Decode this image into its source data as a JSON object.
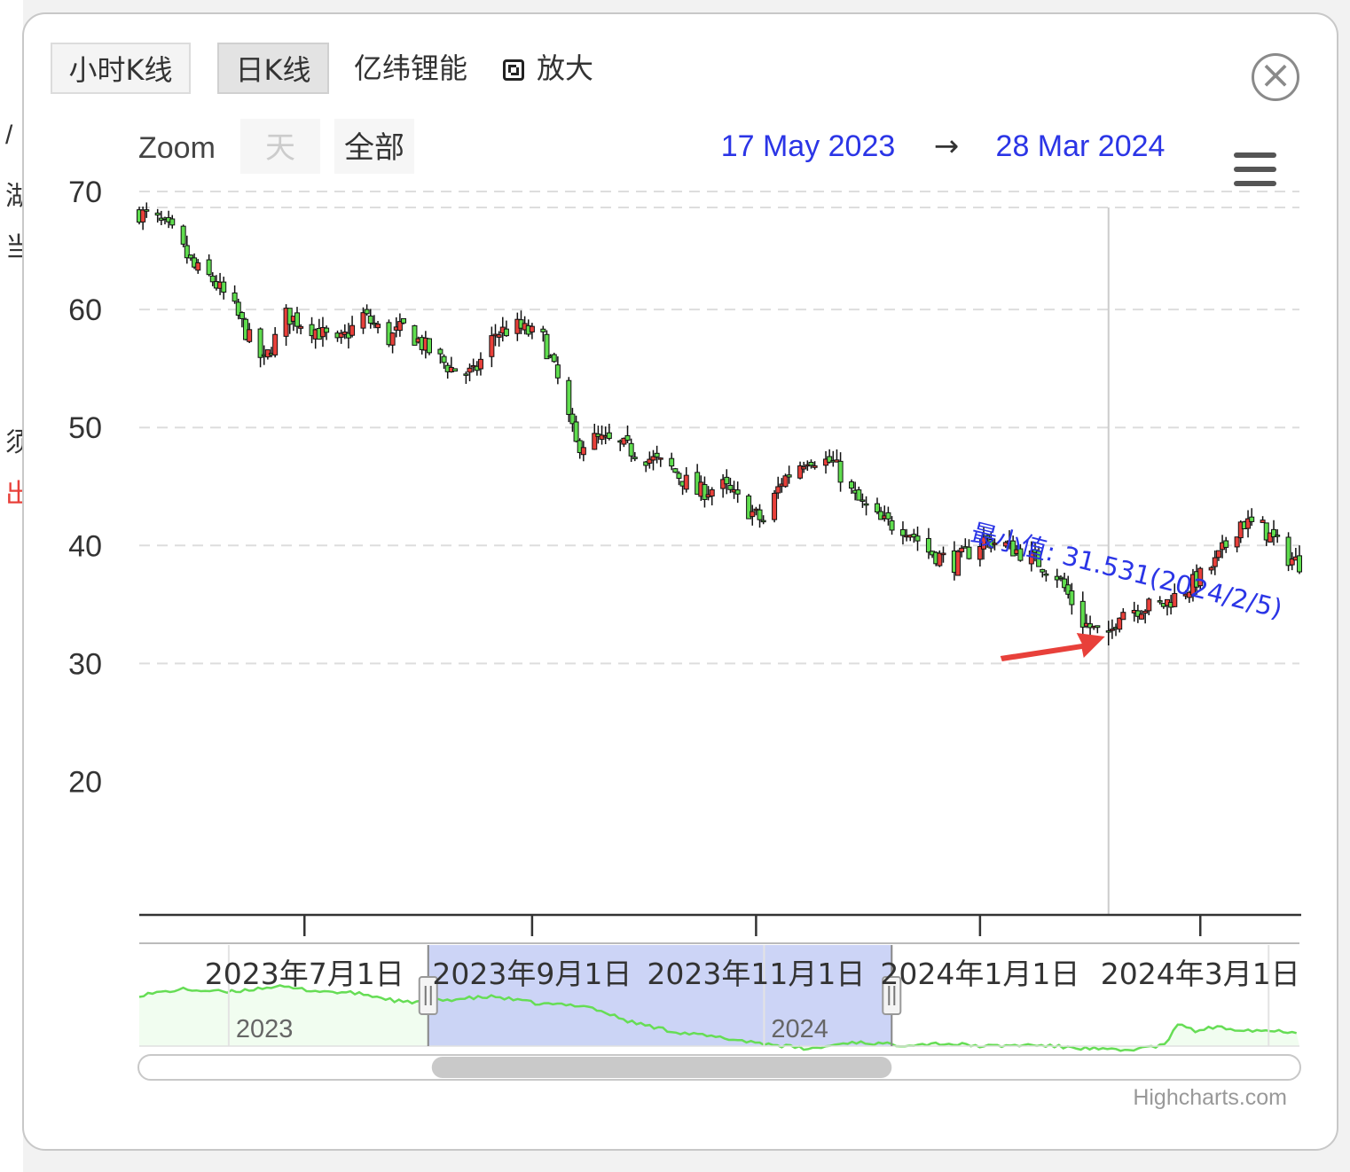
{
  "left_fragments": [
    "/",
    "湖",
    "当",
    "须",
    "出"
  ],
  "tabs": {
    "hour": "小时K线",
    "day": "日K线"
  },
  "stock_name": "亿纬锂能",
  "zoom_toggle": "放大",
  "close_icon": "close-icon",
  "menu_icon": "hamburger-menu-icon",
  "range_selector": {
    "label": "Zoom",
    "buttons": [
      "天",
      "全部"
    ]
  },
  "range_inputs": {
    "from": "17 May 2023",
    "arrow": "→",
    "to": "28 Mar 2024"
  },
  "credits": "Highcharts.com",
  "colors": {
    "up": "#e8403a",
    "down": "#5fdd4e",
    "link": "#2b35e6",
    "navigator_line": "#66dd55",
    "navigator_mask": "#c7cff5"
  },
  "chart_data": {
    "type": "candlestick",
    "y_ticks": [
      70,
      60,
      50,
      40,
      30,
      20
    ],
    "ylim": [
      20,
      75
    ],
    "x_start": "2023-05-17",
    "x_end": "2024-03-28",
    "x_ticks": [
      {
        "date": "2023-07-01",
        "label": "2023年7月1日"
      },
      {
        "date": "2023-09-01",
        "label": "2023年9月1日"
      },
      {
        "date": "2023-11-01",
        "label": "2023年11月1日"
      },
      {
        "date": "2024-01-01",
        "label": "2024年1月1日"
      },
      {
        "date": "2024-03-01",
        "label": "2024年3月1日"
      }
    ],
    "grid": true,
    "crosshair_date": "2024-02-05",
    "min_annotation": {
      "text": "最小值: 31.531(2024/2/5)",
      "date": "2024-02-05",
      "value": 31.531
    },
    "close_trend": [
      [
        "2023-05-17",
        68.2
      ],
      [
        "2023-05-22",
        67.5
      ],
      [
        "2023-05-26",
        66.5
      ],
      [
        "2023-06-01",
        63.5
      ],
      [
        "2023-06-06",
        62.5
      ],
      [
        "2023-06-12",
        60.0
      ],
      [
        "2023-06-16",
        57.5
      ],
      [
        "2023-06-20",
        55.5
      ],
      [
        "2023-06-26",
        59.5
      ],
      [
        "2023-07-03",
        58.5
      ],
      [
        "2023-07-10",
        57.0
      ],
      [
        "2023-07-17",
        59.5
      ],
      [
        "2023-07-24",
        57.5
      ],
      [
        "2023-07-28",
        58.5
      ],
      [
        "2023-08-04",
        56.5
      ],
      [
        "2023-08-10",
        55.0
      ],
      [
        "2023-08-16",
        54.5
      ],
      [
        "2023-08-22",
        58.0
      ],
      [
        "2023-08-28",
        58.5
      ],
      [
        "2023-09-04",
        57.5
      ],
      [
        "2023-09-08",
        54.0
      ],
      [
        "2023-09-13",
        48.5
      ],
      [
        "2023-09-18",
        49.0
      ],
      [
        "2023-09-25",
        48.5
      ],
      [
        "2023-10-09",
        46.5
      ],
      [
        "2023-10-16",
        44.5
      ],
      [
        "2023-10-23",
        45.0
      ],
      [
        "2023-10-30",
        43.0
      ],
      [
        "2023-11-03",
        42.0
      ],
      [
        "2023-11-08",
        45.5
      ],
      [
        "2023-11-15",
        47.5
      ],
      [
        "2023-11-22",
        47.0
      ],
      [
        "2023-11-28",
        44.0
      ],
      [
        "2023-12-05",
        42.0
      ],
      [
        "2023-12-12",
        41.5
      ],
      [
        "2023-12-18",
        39.5
      ],
      [
        "2023-12-25",
        38.5
      ],
      [
        "2024-01-02",
        40.5
      ],
      [
        "2024-01-08",
        40.0
      ],
      [
        "2024-01-15",
        39.0
      ],
      [
        "2024-01-22",
        37.5
      ],
      [
        "2024-01-29",
        33.5
      ],
      [
        "2024-02-05",
        32.0
      ],
      [
        "2024-02-08",
        34.5
      ],
      [
        "2024-02-20",
        35.0
      ],
      [
        "2024-02-27",
        36.5
      ],
      [
        "2024-03-05",
        38.5
      ],
      [
        "2024-03-12",
        42.0
      ],
      [
        "2024-03-18",
        41.5
      ],
      [
        "2024-03-25",
        39.0
      ],
      [
        "2024-03-28",
        38.5
      ]
    ],
    "navigator": {
      "labels": [
        "2023",
        "2024"
      ],
      "full_start": "2022-11-01",
      "full_end": "2024-12-31",
      "selected": [
        "2023-05-17",
        "2024-03-28"
      ],
      "trend": [
        [
          "2022-11-01",
          61.0
        ],
        [
          "2022-12-01",
          63.0
        ],
        [
          "2023-01-01",
          62.0
        ],
        [
          "2023-02-01",
          64.0
        ],
        [
          "2023-03-01",
          62.5
        ],
        [
          "2023-04-01",
          61.5
        ],
        [
          "2023-05-01",
          58.5
        ],
        [
          "2023-06-01",
          59.5
        ],
        [
          "2023-07-01",
          60.5
        ],
        [
          "2023-08-01",
          58.0
        ],
        [
          "2023-09-01",
          57.5
        ],
        [
          "2023-10-01",
          52.0
        ],
        [
          "2023-11-01",
          48.5
        ],
        [
          "2023-12-01",
          46.5
        ],
        [
          "2024-01-01",
          44.5
        ],
        [
          "2024-02-01",
          42.5
        ],
        [
          "2024-03-01",
          45.0
        ],
        [
          "2024-04-01",
          44.0
        ],
        [
          "2024-05-01",
          44.5
        ],
        [
          "2024-06-01",
          43.5
        ],
        [
          "2024-07-01",
          44.0
        ],
        [
          "2024-08-01",
          43.0
        ],
        [
          "2024-09-01",
          42.0
        ],
        [
          "2024-10-01",
          44.0
        ],
        [
          "2024-10-10",
          52.0
        ],
        [
          "2024-10-20",
          48.5
        ],
        [
          "2024-11-01",
          50.0
        ],
        [
          "2024-12-01",
          49.0
        ],
        [
          "2024-12-31",
          48.5
        ]
      ]
    }
  }
}
